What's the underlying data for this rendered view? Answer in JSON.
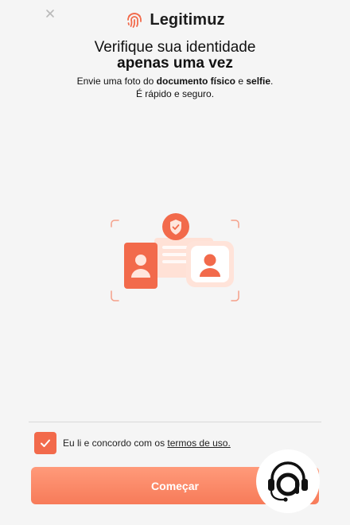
{
  "header": {
    "brand_name": "Legitimuz",
    "logo_icon": "fingerprint-icon",
    "close_icon": "close-icon"
  },
  "intro": {
    "title_line1": "Verifique sua identidade",
    "title_line2": "apenas uma vez",
    "subtitle_prefix": "Envie uma foto do ",
    "subtitle_bold1": "documento físico",
    "subtitle_mid": " e ",
    "subtitle_bold2": "selfie",
    "subtitle_end": ".",
    "subtitle_line2": "É rápido e seguro."
  },
  "consent": {
    "checked": true,
    "text": "Eu li e concordo com os ",
    "link_text": "termos de uso."
  },
  "actions": {
    "start_label": "Começar"
  },
  "support_widget": {
    "icon": "headset-support-icon"
  },
  "colors": {
    "accent": "#f26a4b",
    "accent_light": "#ffd5c7",
    "button_top": "#ff9a7a",
    "button_bottom": "#f77b59",
    "background": "#f5f5f5"
  }
}
